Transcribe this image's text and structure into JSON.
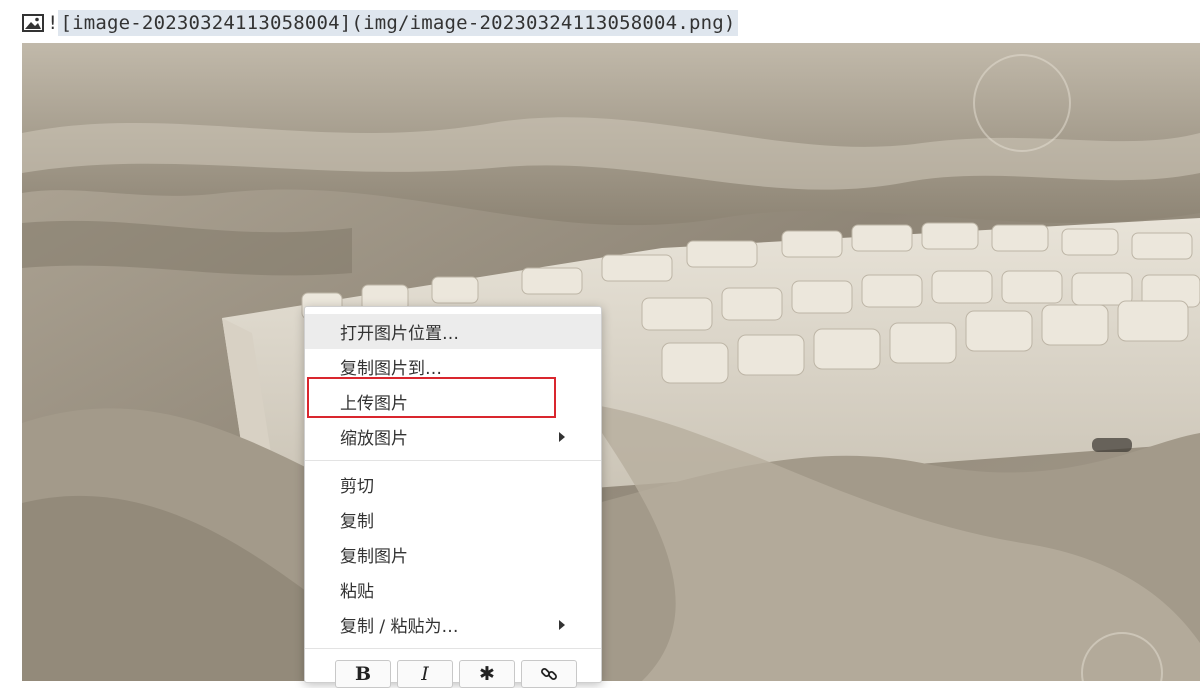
{
  "markdown": {
    "prefix": "!",
    "source": "[image-20230324113058004](img/image-20230324113058004.png)",
    "icon": "image-icon"
  },
  "context_menu": {
    "items": [
      {
        "label": "打开图片位置…",
        "submenu": false
      },
      {
        "label": "复制图片到…",
        "submenu": false
      },
      {
        "label": "上传图片",
        "submenu": false
      },
      {
        "label": "缩放图片",
        "submenu": true
      },
      {
        "label": "剪切",
        "submenu": false
      },
      {
        "label": "复制",
        "submenu": false
      },
      {
        "label": "复制图片",
        "submenu": false
      },
      {
        "label": "粘贴",
        "submenu": false
      },
      {
        "label": "复制 / 粘贴为…",
        "submenu": true
      }
    ],
    "format_buttons": [
      {
        "label": "B",
        "name": "bold-button"
      },
      {
        "label": "I",
        "name": "italic-button"
      },
      {
        "label": "✱",
        "name": "asterisk-button"
      },
      {
        "label": "🔗",
        "name": "link-button"
      }
    ]
  },
  "colors": {
    "highlight_border": "#d9262e",
    "selection_bg": "#dfe6ee"
  }
}
